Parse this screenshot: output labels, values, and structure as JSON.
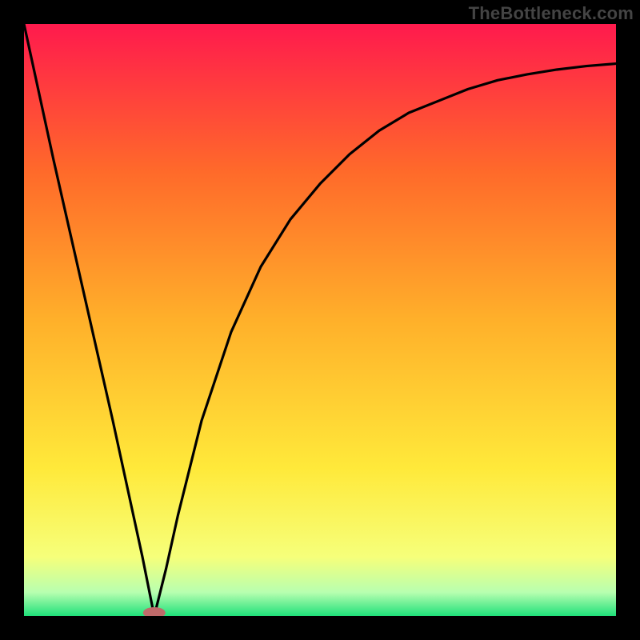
{
  "watermark": "TheBottleneck.com",
  "chart_data": {
    "type": "line",
    "title": "",
    "xlabel": "",
    "ylabel": "",
    "xlim": [
      0,
      100
    ],
    "ylim": [
      0,
      100
    ],
    "grid": false,
    "legend": false,
    "series": [
      {
        "name": "curve",
        "x": [
          0,
          5,
          10,
          15,
          20,
          22,
          24,
          26,
          28,
          30,
          35,
          40,
          45,
          50,
          55,
          60,
          65,
          70,
          75,
          80,
          85,
          90,
          95,
          100
        ],
        "values": [
          100,
          77,
          55,
          33,
          10,
          0,
          8,
          17,
          25,
          33,
          48,
          59,
          67,
          73,
          78,
          82,
          85,
          87,
          89,
          90.5,
          91.5,
          92.3,
          92.9,
          93.3
        ]
      }
    ],
    "marker": {
      "x": 22,
      "y": 0,
      "label": ""
    },
    "gradient_stops": [
      {
        "offset": 0.0,
        "color": "#ff1a4d"
      },
      {
        "offset": 0.25,
        "color": "#ff6a2a"
      },
      {
        "offset": 0.5,
        "color": "#ffb02a"
      },
      {
        "offset": 0.75,
        "color": "#ffe93a"
      },
      {
        "offset": 0.9,
        "color": "#f6ff7a"
      },
      {
        "offset": 0.96,
        "color": "#b8ffb0"
      },
      {
        "offset": 1.0,
        "color": "#1fe07a"
      }
    ]
  }
}
